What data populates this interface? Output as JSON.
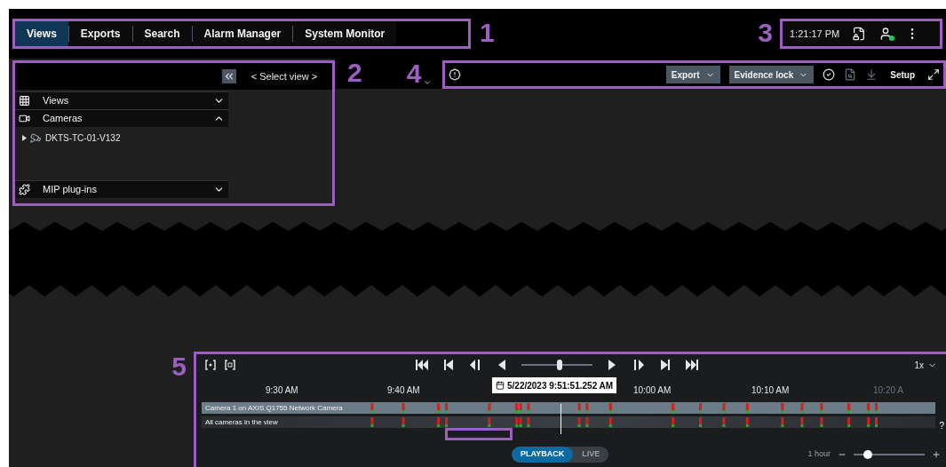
{
  "tabs": [
    {
      "label": "Views",
      "selected": true
    },
    {
      "label": "Exports",
      "selected": false
    },
    {
      "label": "Search",
      "selected": false
    },
    {
      "label": "Alarm Manager",
      "selected": false
    },
    {
      "label": "System Monitor",
      "selected": false
    }
  ],
  "annotations": [
    "1",
    "2",
    "3",
    "4",
    "5"
  ],
  "header": {
    "time": "1:21:17 PM",
    "user_online": true
  },
  "view_pane": {
    "select_view": "< Select view >",
    "sections": [
      {
        "kind": "views",
        "label": "Views",
        "expanded": false
      },
      {
        "kind": "cameras",
        "label": "Cameras",
        "expanded": true,
        "children": [
          {
            "label": "DKTS-TC-01-V132"
          }
        ]
      },
      {
        "kind": "plugins",
        "label": "MIP plug-ins",
        "expanded": false
      }
    ]
  },
  "toolbar": {
    "dropdowns": [
      "Export",
      "Evidence lock"
    ],
    "setup": "Setup"
  },
  "timeline": {
    "speed": "1x",
    "speed_slider": {
      "level": 0.53
    },
    "ticks": [
      "9:30 AM",
      "9:40 AM",
      "10:00 AM",
      "10:10 AM",
      "10:20 A"
    ],
    "current_time": "5/22/2023 9:51:51.252 AM",
    "tracks": [
      {
        "name": "Camera 1 on AXIS Q1755 Network Camera"
      },
      {
        "name": "All cameras in the view"
      }
    ],
    "help": "?",
    "modes": [
      {
        "label": "PLAYBACK",
        "selected": true
      },
      {
        "label": "LIVE",
        "selected": false
      }
    ],
    "span": "1 hour",
    "zoom": {
      "level": 0.2
    }
  }
}
